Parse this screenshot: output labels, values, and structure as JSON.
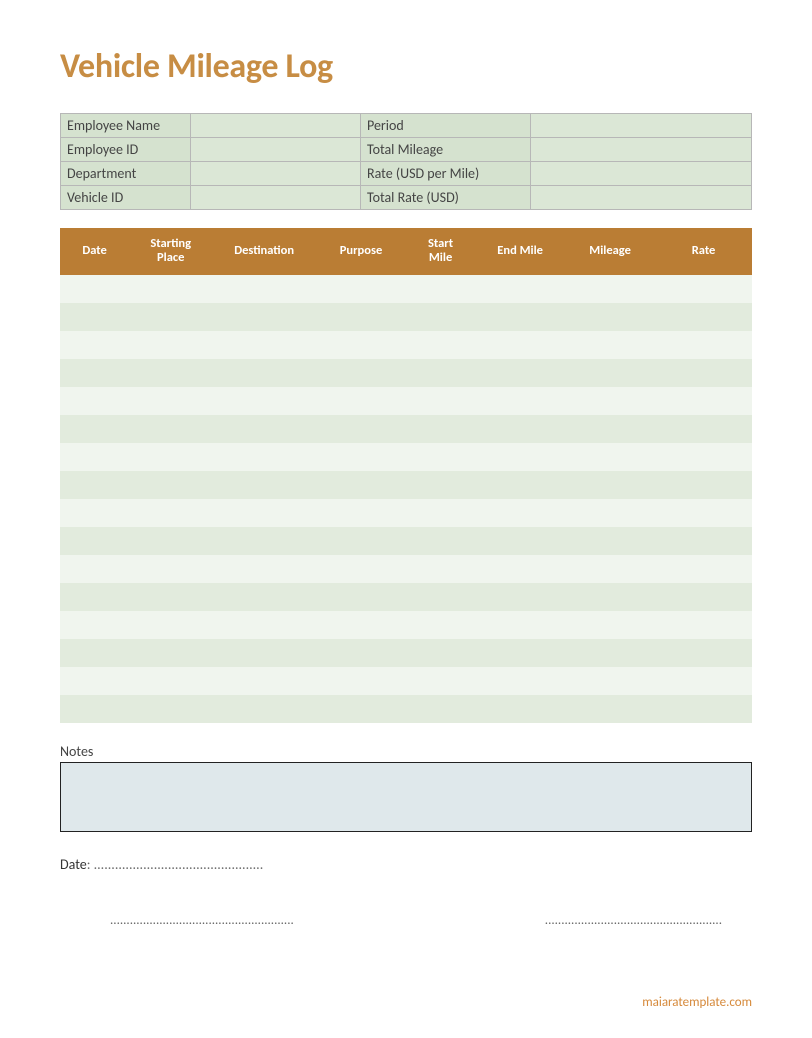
{
  "title": "Vehicle Mileage Log",
  "info": {
    "rows": [
      {
        "label1": "Employee Name",
        "value1": "",
        "label2": "Period",
        "value2": ""
      },
      {
        "label1": "Employee ID",
        "value1": "",
        "label2": "Total Mileage",
        "value2": ""
      },
      {
        "label1": "Department",
        "value1": "",
        "label2": "Rate (USD per Mile)",
        "value2": ""
      },
      {
        "label1": "Vehicle ID",
        "value1": "",
        "label2": "Total Rate (USD)",
        "value2": ""
      }
    ]
  },
  "log": {
    "headers": [
      "Date",
      "Starting Place",
      "Destination",
      "Purpose",
      "Start Mile",
      "End Mile",
      "Mileage",
      "Rate"
    ],
    "rowCount": 16
  },
  "notes": {
    "label": "Notes",
    "text": ""
  },
  "dateLine": {
    "label": "Date",
    "dots": ": ................................................"
  },
  "sig": {
    "left": "........................................................",
    "right": "......................................................"
  },
  "footer": "maiaratemplate.com"
}
